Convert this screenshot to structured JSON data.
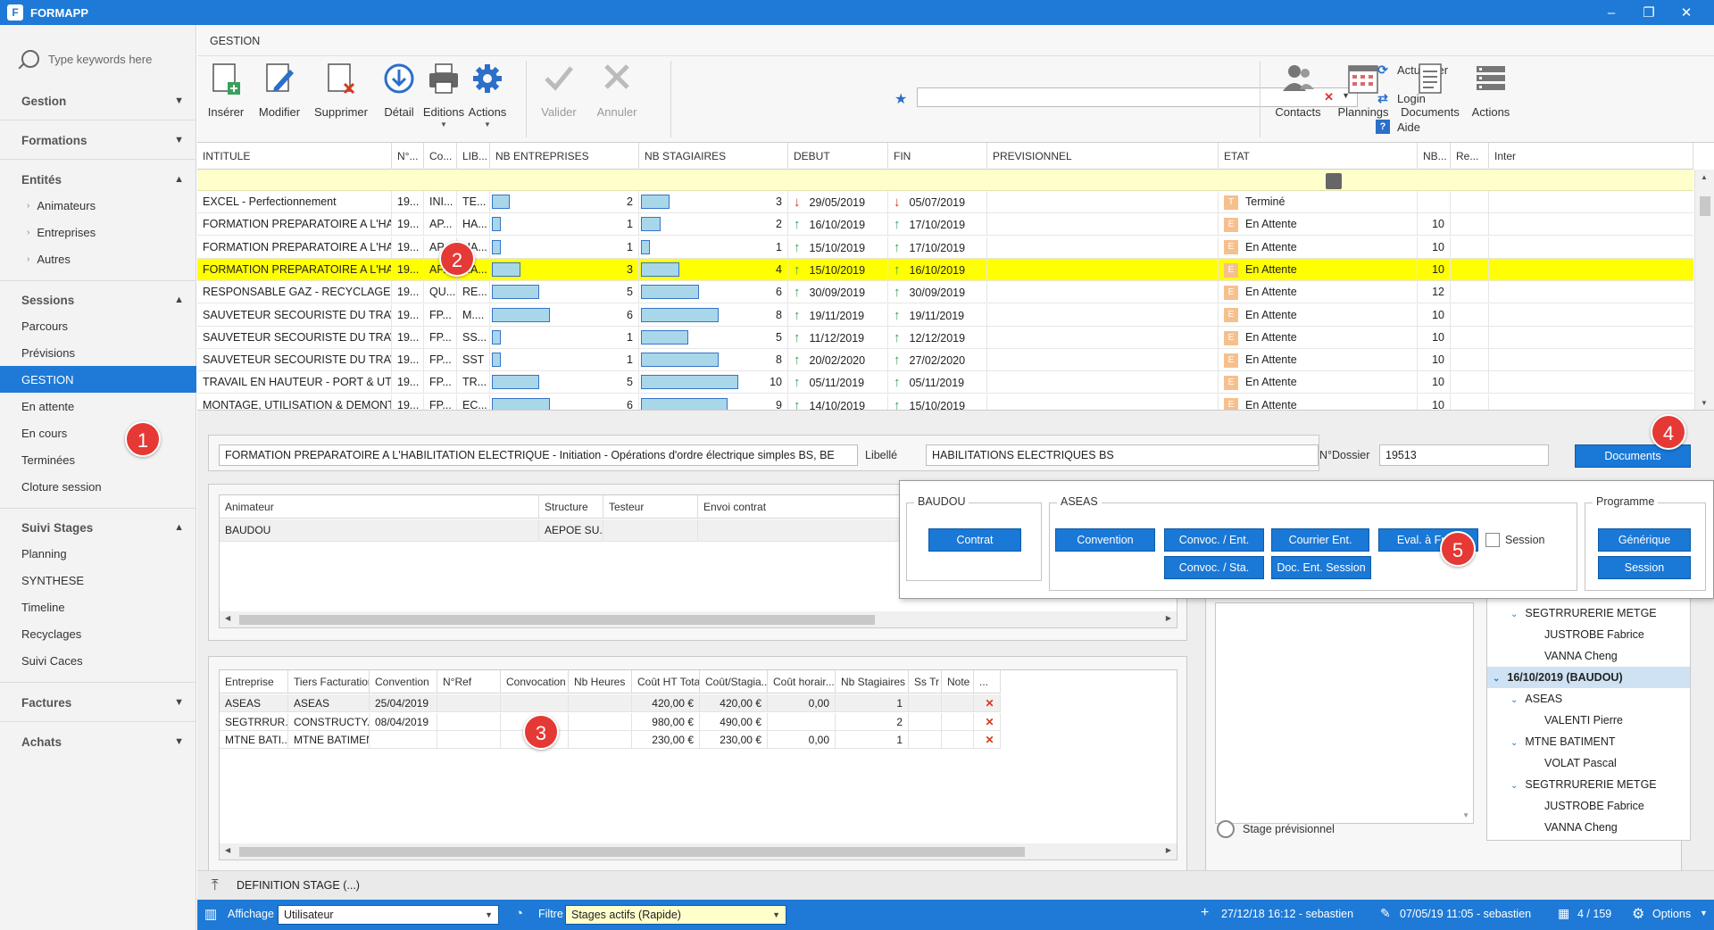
{
  "app": {
    "title": "FORMAPP",
    "logo_letter": "F"
  },
  "window_controls": [
    "–",
    "❐",
    "✕"
  ],
  "sidebar": {
    "search_placeholder": "Type keywords here",
    "sections": {
      "gestion": "Gestion",
      "formations": "Formations",
      "entites": "Entités",
      "sessions": "Sessions",
      "suivi_stages": "Suivi Stages",
      "factures": "Factures",
      "achats": "Achats"
    },
    "entites_items": [
      "Animateurs",
      "Entreprises",
      "Autres"
    ],
    "sessions_items": [
      "Parcours",
      "Prévisions",
      "GESTION",
      "En attente",
      "En cours",
      "Terminées",
      "Cloture session"
    ],
    "suivi_items": [
      "Planning",
      "SYNTHESE",
      "Timeline",
      "Recyclages",
      "Suivi Caces"
    ]
  },
  "ribbon": {
    "title": "GESTION",
    "buttons": [
      "Insérer",
      "Modifier",
      "Supprimer",
      "Détail",
      "Editions",
      "Actions",
      "Valider",
      "Annuler"
    ],
    "links": [
      "Actualiser",
      "Login",
      "Aide"
    ],
    "right_buttons": [
      "Contacts",
      "Plannings",
      "Documents",
      "Actions"
    ],
    "favorite_value": ""
  },
  "grid": {
    "columns": [
      "INTITULE",
      "N°...",
      "Co...",
      "LIB...",
      "NB ENTREPRISES",
      "NB STAGIAIRES",
      "DEBUT",
      "FIN",
      "PREVISIONNEL",
      "ETAT",
      "NB...",
      "Re...",
      "Inter"
    ],
    "rows": [
      {
        "intitule": "EXCEL - Perfectionnement",
        "no": "19...",
        "co": "INI...",
        "lib": "TE...",
        "ent": 2,
        "ent_frac": 0.12,
        "stag": 3,
        "stag_frac": 0.19,
        "debut": "29/05/2019",
        "fin": "05/07/2019",
        "dir": "down",
        "etat_code": "T",
        "etat": "Terminé",
        "nb": ""
      },
      {
        "intitule": "FORMATION PREPARATOIRE A L'HABILITA...",
        "no": "19...",
        "co": "AP...",
        "lib": "HA...",
        "ent": 1,
        "ent_frac": 0.06,
        "stag": 2,
        "stag_frac": 0.13,
        "debut": "16/10/2019",
        "fin": "17/10/2019",
        "dir": "up",
        "etat_code": "E",
        "etat": "En Attente",
        "nb": "10"
      },
      {
        "intitule": "FORMATION PREPARATOIRE A L'HABILITA...",
        "no": "19...",
        "co": "AP...",
        "lib": "HA...",
        "ent": 1,
        "ent_frac": 0.06,
        "stag": 1,
        "stag_frac": 0.06,
        "debut": "15/10/2019",
        "fin": "17/10/2019",
        "dir": "up",
        "etat_code": "E",
        "etat": "En Attente",
        "nb": "10"
      },
      {
        "intitule": "FORMATION PREPARATOIRE A L'HABILITA...",
        "no": "19...",
        "co": "AP...",
        "lib": "HA...",
        "ent": 3,
        "ent_frac": 0.19,
        "stag": 4,
        "stag_frac": 0.26,
        "debut": "15/10/2019",
        "fin": "16/10/2019",
        "dir": "up",
        "etat_code": "E",
        "etat": "En Attente",
        "nb": "10",
        "selected": true
      },
      {
        "intitule": "RESPONSABLE GAZ - RECYCLAGE",
        "no": "19...",
        "co": "QU...",
        "lib": "RE...",
        "ent": 5,
        "ent_frac": 0.32,
        "stag": 6,
        "stag_frac": 0.39,
        "debut": "30/09/2019",
        "fin": "30/09/2019",
        "dir": "up",
        "etat_code": "E",
        "etat": "En Attente",
        "nb": "12"
      },
      {
        "intitule": "SAUVETEUR SECOURISTE DU TRAVAIL -...",
        "no": "19...",
        "co": "FP...",
        "lib": "M....",
        "ent": 6,
        "ent_frac": 0.39,
        "stag": 8,
        "stag_frac": 0.52,
        "debut": "19/11/2019",
        "fin": "19/11/2019",
        "dir": "up",
        "etat_code": "E",
        "etat": "En Attente",
        "nb": "10"
      },
      {
        "intitule": "SAUVETEUR SECOURISTE DU TRAVAIL",
        "no": "19...",
        "co": "FP...",
        "lib": "SS...",
        "ent": 1,
        "ent_frac": 0.06,
        "stag": 5,
        "stag_frac": 0.32,
        "debut": "11/12/2019",
        "fin": "12/12/2019",
        "dir": "up",
        "etat_code": "E",
        "etat": "En Attente",
        "nb": "10"
      },
      {
        "intitule": "SAUVETEUR SECOURISTE DU TRAVAIL",
        "no": "19...",
        "co": "FP...",
        "lib": "SST",
        "ent": 1,
        "ent_frac": 0.06,
        "stag": 8,
        "stag_frac": 0.52,
        "debut": "20/02/2020",
        "fin": "27/02/2020",
        "dir": "up",
        "etat_code": "E",
        "etat": "En Attente",
        "nb": "10"
      },
      {
        "intitule": "TRAVAIL EN HAUTEUR - PORT & UTILISA...",
        "no": "19...",
        "co": "FP...",
        "lib": "TR...",
        "ent": 5,
        "ent_frac": 0.32,
        "stag": 10,
        "stag_frac": 0.65,
        "debut": "05/11/2019",
        "fin": "05/11/2019",
        "dir": "up",
        "etat_code": "E",
        "etat": "En Attente",
        "nb": "10"
      },
      {
        "intitule": "MONTAGE, UTILISATION & DEMONTAGE...",
        "no": "19...",
        "co": "FP...",
        "lib": "EC...",
        "ent": 6,
        "ent_frac": 0.39,
        "stag": 9,
        "stag_frac": 0.58,
        "debut": "14/10/2019",
        "fin": "15/10/2019",
        "dir": "up",
        "etat_code": "E",
        "etat": "En Attente",
        "nb": "10"
      }
    ]
  },
  "detail": {
    "intitule": "FORMATION PREPARATOIRE A L'HABILITATION ELECTRIQUE - Initiation - Opérations d'ordre électrique simples BS, BE",
    "libelle_label": "Libellé",
    "libelle": "HABILITATIONS ELECTRIQUES BS",
    "dossier_label": "N°Dossier",
    "dossier": "19513",
    "documents_button": "Documents"
  },
  "animateurs": {
    "columns": [
      "Animateur",
      "Structure",
      "Testeur",
      "Envoi contrat"
    ],
    "rows": [
      [
        "BAUDOU",
        "AEPOE SU...",
        "",
        ""
      ]
    ]
  },
  "entreprises": {
    "columns": [
      "Entreprise",
      "Tiers Facturation",
      "Convention",
      "N°Ref",
      "Convocation",
      "Nb Heures",
      "Coût HT Total",
      "Coût/Stagia...",
      "Coût horair...",
      "Nb Stagiaires",
      "Ss Tr",
      "Note",
      "..."
    ],
    "rows": [
      [
        "ASEAS",
        "ASEAS",
        "25/04/2019",
        "",
        "",
        "",
        "420,00 €",
        "420,00 €",
        "0,00",
        "1",
        "",
        ""
      ],
      [
        "SEGTRRUR...",
        "CONSTRUCTY...",
        "08/04/2019",
        "",
        "",
        "",
        "980,00 €",
        "490,00 €",
        "",
        "2",
        "",
        ""
      ],
      [
        "MTNE BATI...",
        "MTNE BATIMENT",
        "",
        "",
        "",
        "",
        "230,00 €",
        "230,00 €",
        "0,00",
        "1",
        "",
        ""
      ]
    ]
  },
  "popup": {
    "baudou_label": "BAUDOU",
    "contrat": "Contrat",
    "aseas_label": "ASEAS",
    "convention": "Convention",
    "convoc_ent": "Convoc. / Ent.",
    "courrier_ent": "Courrier Ent.",
    "eval_froid": "Eval. à Froid",
    "session_check": "Session",
    "convoc_sta": "Convoc. / Sta.",
    "doc_ent_session": "Doc. Ent. Session",
    "programme_label": "Programme",
    "generique": "Générique",
    "session": "Session"
  },
  "tree": {
    "rows": [
      {
        "level": 1,
        "text": "SEGTRRURERIE METGE",
        "chev": "⌄"
      },
      {
        "level": 2,
        "text": "JUSTROBE Fabrice"
      },
      {
        "level": 2,
        "text": "VANNA Cheng"
      },
      {
        "level": 0,
        "text": "16/10/2019 (BAUDOU)",
        "chev": "⌄",
        "highlight": true
      },
      {
        "level": 1,
        "text": "ASEAS",
        "chev": "⌄"
      },
      {
        "level": 2,
        "text": "VALENTI Pierre"
      },
      {
        "level": 1,
        "text": "MTNE BATIMENT",
        "chev": "⌄"
      },
      {
        "level": 2,
        "text": "VOLAT Pascal"
      },
      {
        "level": 1,
        "text": "SEGTRRURERIE METGE",
        "chev": "⌄"
      },
      {
        "level": 2,
        "text": "JUSTROBE Fabrice"
      },
      {
        "level": 2,
        "text": "VANNA Cheng"
      }
    ]
  },
  "stage_previsionnel": "Stage prévisionnel",
  "definition_stage": "DEFINITION STAGE (...)",
  "statusbar": {
    "affichage_label": "Affichage",
    "affichage_value": "Utilisateur",
    "filtre_label": "Filtre",
    "filtre_value": "Stages actifs (Rapide)",
    "created": "27/12/18 16:12 - sebastien",
    "modified": "07/05/19 11:05 - sebastien",
    "count": "4 / 159",
    "options": "Options"
  },
  "badges": [
    "1",
    "2",
    "3",
    "4",
    "5"
  ],
  "colors": {
    "accent": "#1e7ad6",
    "selected_row": "#ffff00",
    "filter_row": "#ffffcc",
    "badge": "#e53935"
  }
}
